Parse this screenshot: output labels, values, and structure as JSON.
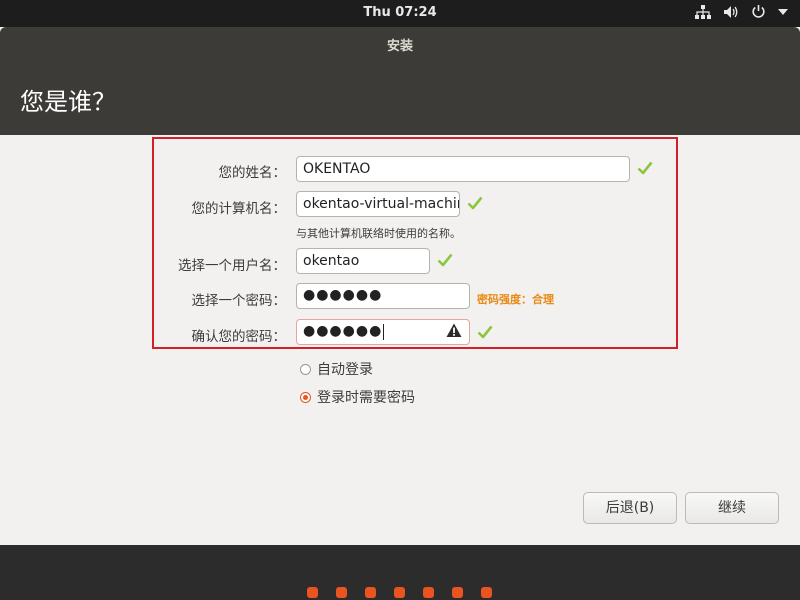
{
  "topbar": {
    "clock": "Thu 07:24"
  },
  "window": {
    "title": "安装",
    "heading": "您是谁？"
  },
  "form": {
    "name_label": "您的姓名：",
    "name_value": "OKENTAO",
    "computer_label": "您的计算机名：",
    "computer_value": "okentao-virtual-machir",
    "computer_hint": "与其他计算机联络时使用的名称。",
    "username_label": "选择一个用户名：",
    "username_value": "okentao",
    "password_label": "选择一个密码：",
    "password_value": "●●●●●●",
    "password_strength": "密码强度：合理",
    "confirm_label": "确认您的密码：",
    "confirm_value": "●●●●●●"
  },
  "login_options": {
    "auto_login_label": "自动登录",
    "require_password_label": "登录时需要密码",
    "selected": "require_password"
  },
  "buttons": {
    "back_label": "后退(B)",
    "continue_label": "继续"
  },
  "colors": {
    "accent": "#e95420",
    "check": "#8cc63f",
    "highlight_box": "#d1202a",
    "strength": "#e98a15"
  },
  "icons": {
    "network": "network-icon",
    "volume": "volume-icon",
    "power": "power-icon",
    "menu": "chevron-down-icon",
    "valid": "checkmark-icon",
    "warning": "warning-icon"
  }
}
